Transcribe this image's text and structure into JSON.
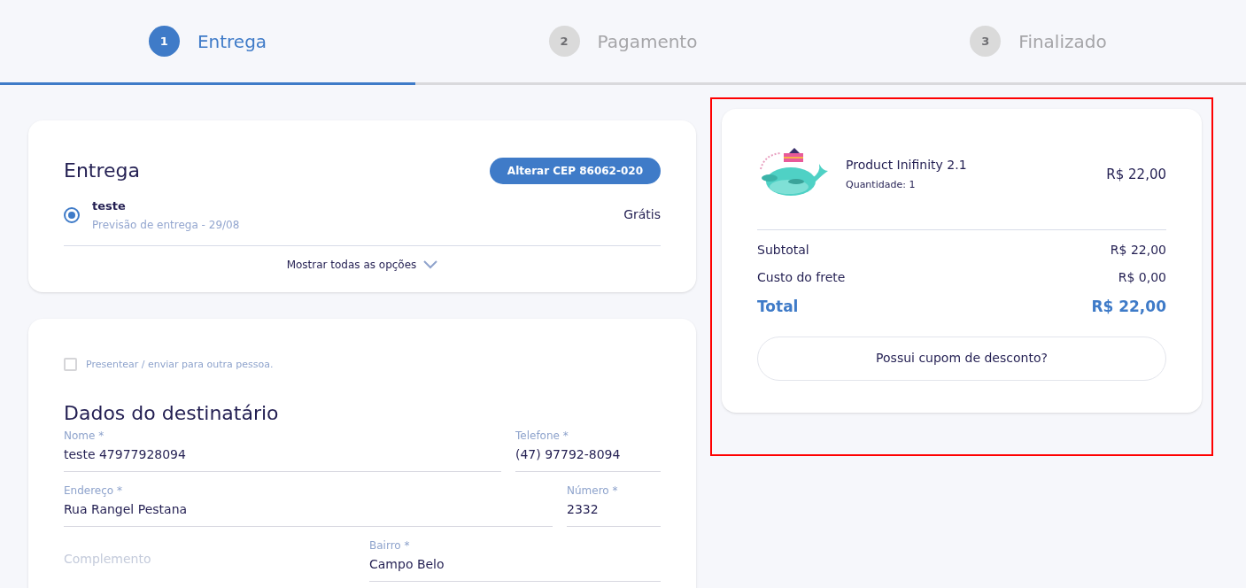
{
  "steps": [
    {
      "number": "1",
      "label": "Entrega",
      "selected": true
    },
    {
      "number": "2",
      "label": "Pagamento",
      "selected": false
    },
    {
      "number": "3",
      "label": "Finalizado",
      "selected": false
    }
  ],
  "delivery": {
    "title": "Entrega",
    "change_button": "Alterar CEP 86062-020",
    "options": [
      {
        "name": "teste",
        "estimate": "Previsão de entrega - 29/08",
        "price": "Grátis",
        "selected": true
      }
    ],
    "show_all": "Mostrar todas as opções"
  },
  "recipient": {
    "gift_checkbox": {
      "label": "Presentear / enviar para outra pessoa.",
      "checked": false
    },
    "title": "Dados do destinatário",
    "field_rows": [
      [
        {
          "label": "Nome *",
          "value": "teste 47977928094"
        },
        {
          "label": "Telefone *",
          "value": "(47) 97792-8094"
        }
      ],
      [
        {
          "label": "Endereço *",
          "value": "Rua Rangel Pestana"
        },
        {
          "label": "Número *",
          "value": "2332"
        }
      ],
      [
        {
          "placeholder": "Complemento"
        },
        {
          "label": "Bairro *",
          "value": "Campo Belo"
        }
      ]
    ]
  },
  "summary": {
    "highlighted": true,
    "items": [
      {
        "kind": "picture",
        "name": "Product Inifinity 2.1",
        "quantity": "Quantidade: 1",
        "price": "R$ 22,00"
      }
    ],
    "lines": [
      {
        "label": "Subtotal",
        "value": "R$ 22,00",
        "kind": "normal"
      },
      {
        "label": "Custo do frete",
        "value": "R$ 0,00",
        "kind": "normal"
      },
      {
        "label": "Total",
        "value": "R$ 22,00",
        "kind": "total"
      }
    ],
    "coupon_button": "Possui cupom de desconto?"
  }
}
